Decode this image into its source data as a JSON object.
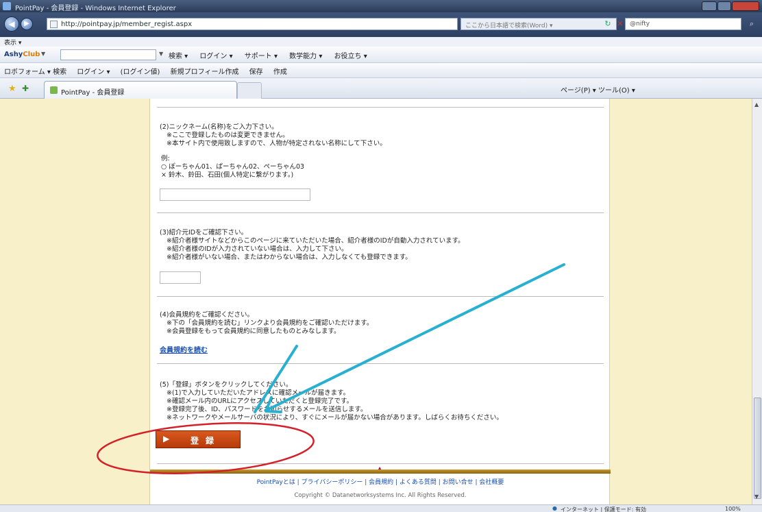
{
  "window": {
    "title": "PointPay - 会員登録 - Windows Internet Explorer"
  },
  "address": {
    "url": "http://pointpay.jp/member_regist.aspx",
    "keyword_placeholder": "ここから日本語で検索(Word) ▾",
    "search_value": "@nifty"
  },
  "menubar": {
    "label": "表示 ▾"
  },
  "toolbar1": {
    "brand_a": "Ashy",
    "brand_b": "Club",
    "items": [
      "検索 ▾",
      "ログイン ▾",
      "サポート ▾",
      "数学能力 ▾",
      "お役立ち ▾"
    ]
  },
  "toolbar2": {
    "items": [
      "ロボフォーム ▾ 検索",
      "ログイン ▾",
      "(ログイン値)",
      "新規プロフィール作成",
      "保存",
      "作成"
    ]
  },
  "tab": {
    "label": "PointPay - 会員登録",
    "commands": "ページ(P) ▾  ツール(O) ▾"
  },
  "form": {
    "sec2": {
      "head": "(2)ニックネーム(名称)をご入力下さい。",
      "notes": [
        "※ここで登録したものは変更できません。",
        "※本サイト内で使用致しますので、人物が特定されない名称にして下さい。"
      ],
      "ex_label": "例:",
      "ex_ok": "○ ぽーちゃん01、ぱーちゃん02、ペーちゃん03",
      "ex_ng": "× 鈴木、鈴田、石田(個人特定に繋がります。)"
    },
    "sec3": {
      "head": "(3)紹介元IDをご確認下さい。",
      "notes": [
        "※紹介者様サイトなどからこのページに来ていただいた場合、紹介者様のIDが自動入力されています。",
        "※紹介者様のIDが入力されていない場合は、入力して下さい。",
        "※紹介者様がいない場合、またはわからない場合は、入力しなくても登録できます。"
      ]
    },
    "sec4": {
      "head": "(4)会員規約をご確認ください。",
      "notes": [
        "※下の「会員規約を読む」リンクより会員規約をご確認いただけます。",
        "※会員登録をもって会員規約に同意したものとみなします。"
      ],
      "link": "会員規約を読む"
    },
    "sec5": {
      "head": "(5)「登録」ボタンをクリックしてください。",
      "notes": [
        "※(1)で入力していただいたアドレスに確認メールが届きます。",
        "※確認メール内のURLにアクセスしていただくと登録完了です。",
        "※登録完了後、ID、パスワードをお知らせするメールを送信します。",
        "※ネットワークやメールサーバの状況により、すぐにメールが届かない場合があります。しばらくお待ちください。"
      ]
    },
    "register_button": "登録"
  },
  "footer": {
    "links": "PointPayとは | プライバシーポリシー | 会員規約 | よくある質問 | お問い合せ | 会社概要",
    "copyright": "Copyright © Datanetworksystems Inc. All Rights Reserved."
  },
  "status": {
    "zone": "インターネット | 保護モード: 有効",
    "zoom": "100%"
  },
  "colors": {
    "page_bg": "#f8f0c8",
    "register_button": "#c8481a",
    "annotation_arrow": "#29b0d0",
    "annotation_circle": "#d4202a"
  }
}
